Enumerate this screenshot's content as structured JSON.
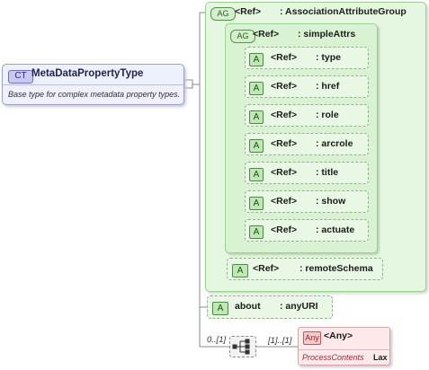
{
  "complex_type": {
    "badge": "CT",
    "name": "MetaDataPropertyType",
    "doc": "Base type for complex metadata property types."
  },
  "association_group": {
    "badge": "AG",
    "ref": "<Ref>",
    "name": ": AssociationAttributeGroup"
  },
  "simple_attrs": {
    "badge": "AG",
    "ref": "<Ref>",
    "name": ": simpleAttrs",
    "attributes": [
      {
        "badge": "A",
        "ref": "<Ref>",
        "name": ": type"
      },
      {
        "badge": "A",
        "ref": "<Ref>",
        "name": ": href"
      },
      {
        "badge": "A",
        "ref": "<Ref>",
        "name": ": role"
      },
      {
        "badge": "A",
        "ref": "<Ref>",
        "name": ": arcrole"
      },
      {
        "badge": "A",
        "ref": "<Ref>",
        "name": ": title"
      },
      {
        "badge": "A",
        "ref": "<Ref>",
        "name": ": show"
      },
      {
        "badge": "A",
        "ref": "<Ref>",
        "name": ": actuate"
      }
    ]
  },
  "remote_schema": {
    "badge": "A",
    "ref": "<Ref>",
    "name": ": remoteSchema"
  },
  "about": {
    "badge": "A",
    "ref": "about",
    "name": ": anyURI"
  },
  "sequence": {
    "min_card": "0..[1]",
    "max_card": "[1]..[1]"
  },
  "any": {
    "badge": "Any",
    "title": "<Any>",
    "process_contents_label": "ProcessContents",
    "process_contents_value": "Lax"
  }
}
